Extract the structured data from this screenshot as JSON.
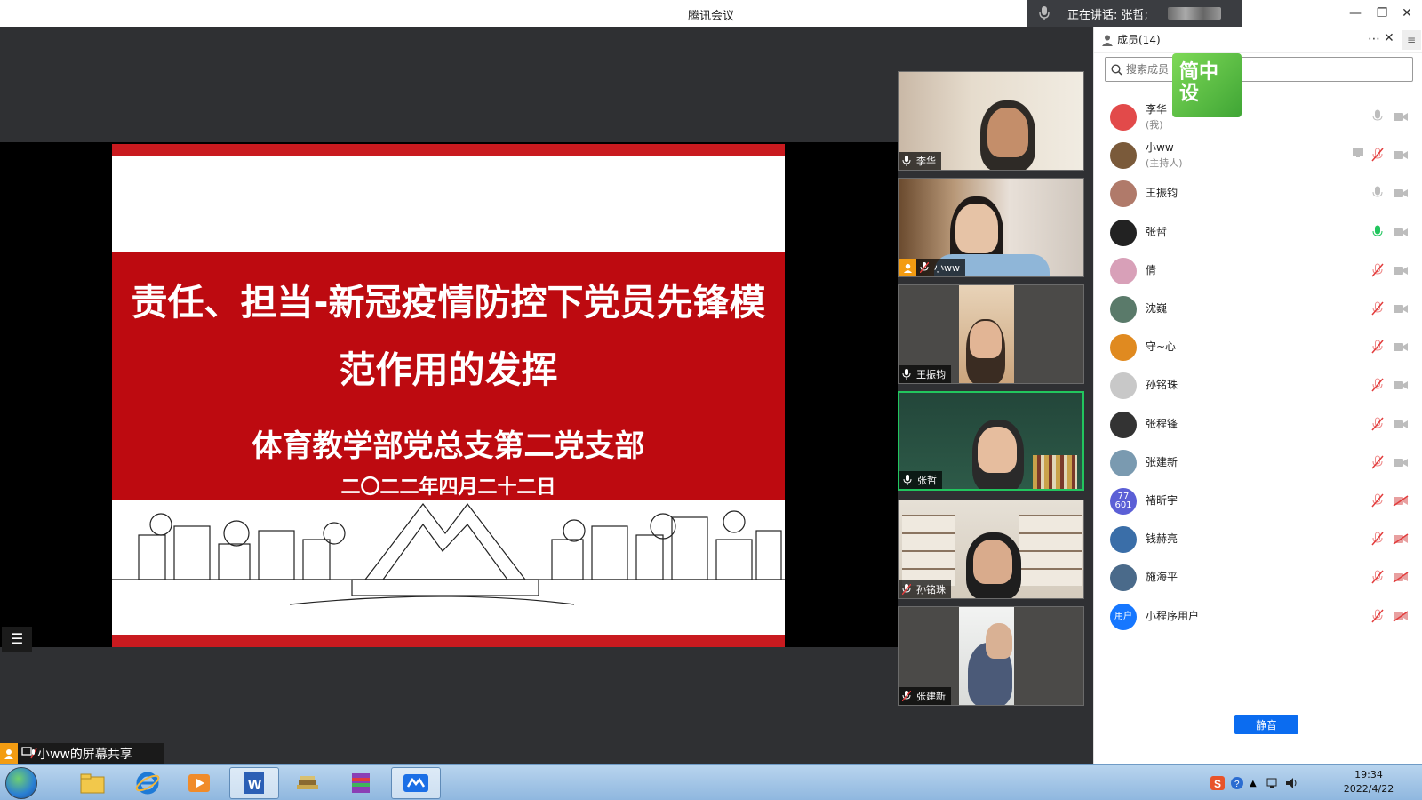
{
  "window": {
    "title": "腾讯会议",
    "speaking_text": "正在讲话: 张哲;"
  },
  "slide": {
    "title_line1": "责任、担当-新冠疫情防控下党员先锋模",
    "title_line2": "范作用的发挥",
    "organization": "体育教学部党总支第二党支部",
    "date": "二〇二二年四月二十二日"
  },
  "share_label": "小ww的屏幕共享",
  "videos": [
    {
      "name": "李华",
      "mic": "on"
    },
    {
      "name": "小ww",
      "mic": "muted",
      "host": true
    },
    {
      "name": "王振钧",
      "mic": "on"
    },
    {
      "name": "张哲",
      "mic": "on",
      "active": true
    },
    {
      "name": "孙铭珠",
      "mic": "muted"
    },
    {
      "name": "张建新",
      "mic": "muted"
    }
  ],
  "panel": {
    "header": "成员(14)",
    "search_placeholder": "搜索成员",
    "badge_text": "简中设",
    "mute_all": "静音",
    "members": [
      {
        "name": "李华",
        "role": "(我)",
        "mic": "off-gray",
        "cam": "gray",
        "avatar_color": "#e24a4a"
      },
      {
        "name": "小ww",
        "role": "(主持人)",
        "mic": "muted",
        "cam": "gray",
        "screen": true,
        "avatar_color": "#7a5a3a"
      },
      {
        "name": "王振钧",
        "role": "",
        "mic": "off-gray",
        "cam": "gray",
        "avatar_color": "#b07a6a"
      },
      {
        "name": "张哲",
        "role": "",
        "mic": "active",
        "cam": "gray",
        "avatar_color": "#222222"
      },
      {
        "name": "倩",
        "role": "",
        "mic": "muted",
        "cam": "gray",
        "avatar_color": "#d8a0b8"
      },
      {
        "name": "沈巍",
        "role": "",
        "mic": "muted",
        "cam": "gray",
        "avatar_color": "#5a7a6a"
      },
      {
        "name": "守~心",
        "role": "",
        "mic": "muted",
        "cam": "gray",
        "avatar_color": "#e08a20"
      },
      {
        "name": "孙铭珠",
        "role": "",
        "mic": "muted",
        "cam": "gray",
        "avatar_color": "#c8c8c8"
      },
      {
        "name": "张程锋",
        "role": "",
        "mic": "muted",
        "cam": "gray",
        "avatar_color": "#333333"
      },
      {
        "name": "张建新",
        "role": "",
        "mic": "muted",
        "cam": "gray",
        "avatar_color": "#7a9ab0"
      },
      {
        "name": "褚昕宇",
        "role": "",
        "mic": "muted",
        "cam": "muted",
        "avatar_color": "#5b5fd6",
        "avatar_text": "77 601"
      },
      {
        "name": "钱赫亮",
        "role": "",
        "mic": "muted",
        "cam": "muted",
        "avatar_color": "#3a6ea8"
      },
      {
        "name": "施海平",
        "role": "",
        "mic": "muted",
        "cam": "muted",
        "avatar_color": "#4a6a8a"
      },
      {
        "name": "小程序用户",
        "role": "",
        "mic": "muted",
        "cam": "muted",
        "avatar_color": "#1677ff",
        "avatar_text": "用户"
      }
    ]
  },
  "taskbar": {
    "time": "19:34",
    "date": "2022/4/22"
  },
  "colors": {
    "slide_red": "#bd0a10",
    "accent_blue": "#0b6cf0",
    "active_green": "#22c55e",
    "mute_red": "#e23c3c"
  }
}
